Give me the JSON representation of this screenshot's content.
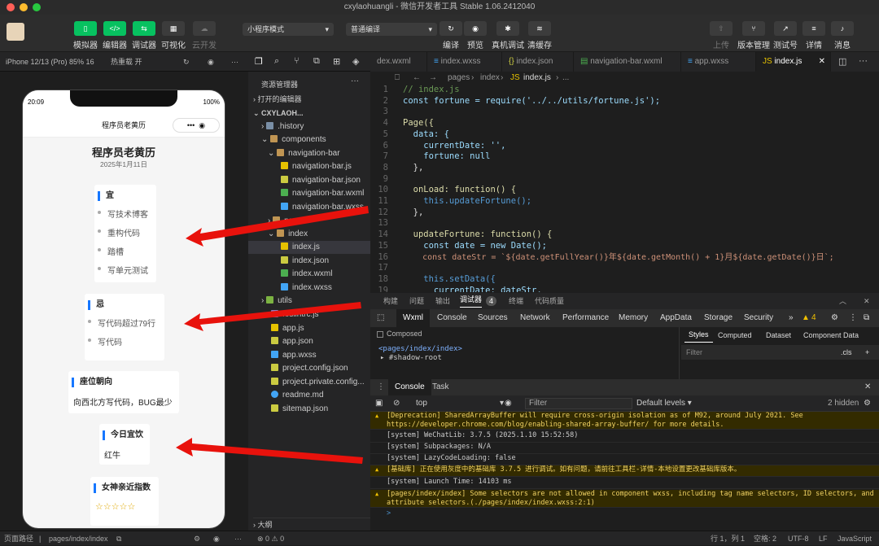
{
  "window_title": "cxylaohuangli - 微信开发者工具 Stable 1.06.2412040",
  "toolbar": {
    "simulator": "模拟器",
    "editor": "编辑器",
    "debugger": "调试器",
    "visual": "可视化",
    "cloud": "云开发",
    "mode": "小程序模式",
    "compile": "普通编译",
    "compile_btn": "编译",
    "preview": "预览",
    "realdebug": "真机调试",
    "clearcache": "清缓存",
    "upload": "上传",
    "version": "版本管理",
    "testno": "测试号",
    "detail": "详情",
    "message": "消息"
  },
  "device": {
    "model": "iPhone 12/13 (Pro) 85% 16",
    "hotreload": "热重载 开"
  },
  "phone": {
    "time": "20:09",
    "battery": "100%",
    "nav_title": "程序员老黄历",
    "page_title": "程序员老黄历",
    "date": "2025年1月11日",
    "yi": {
      "title": "宜",
      "items": [
        "写技术博客",
        "重构代码",
        "踏槽",
        "写单元测试"
      ]
    },
    "ji": {
      "title": "忌",
      "items": [
        "写代码超过79行",
        "写代码"
      ]
    },
    "seat": {
      "title": "座位朝向",
      "text": "向西北方写代码，BUG最少"
    },
    "drink": {
      "title": "今日宜饮",
      "text": "红牛"
    },
    "goddess": {
      "title": "女神亲近指数",
      "stars": "☆☆☆☆☆"
    }
  },
  "explorer": {
    "title": "资源管理器",
    "open_editors": "打开的编辑器",
    "project": "CXYLAOH...",
    "items": [
      ".history",
      "components",
      "navigation-bar",
      "navigation-bar.js",
      "navigation-bar.json",
      "navigation-bar.wxml",
      "navigation-bar.wxss",
      "pages",
      "index",
      "index.js",
      "index.json",
      "index.wxml",
      "index.wxss",
      "utils",
      ".eslintrc.js",
      "app.js",
      "app.json",
      "app.wxss",
      "project.config.json",
      "project.private.config...",
      "readme.md",
      "sitemap.json"
    ],
    "outline": "大纲"
  },
  "tabs": [
    "dex.wxml",
    "index.wxss",
    "index.json",
    "navigation-bar.wxml",
    "app.wxss",
    "index.js"
  ],
  "breadcrumb": {
    "pages": "pages",
    "index": "index",
    "file": "index.js",
    "more": "..."
  },
  "code_lines": [
    "// index.js",
    "const fortune = require('../../utils/fortune.js');",
    "",
    "Page({",
    "  data: {",
    "    currentDate: '',",
    "    fortune: null",
    "  },",
    "",
    "  onLoad: function() {",
    "    this.updateFortune();",
    "  },",
    "",
    "  updateFortune: function() {",
    "    const date = new Date();",
    "    const dateStr = `${date.getFullYear()}年${date.getMonth() + 1}月${date.getDate()}日`;",
    "",
    "    this.setData({",
    "      currentDate: dateStr,"
  ],
  "line_numbers": [
    "1",
    "2",
    "3",
    "4",
    "5",
    "6",
    "7",
    "8",
    "9",
    "10",
    "11",
    "12",
    "13",
    "14",
    "15",
    "16",
    "17",
    "18",
    "19"
  ],
  "devtools": {
    "tabs1": [
      "构建",
      "问题",
      "输出",
      "调试器",
      "4",
      "终端",
      "代码质量"
    ],
    "tabs2": [
      "Wxml",
      "Console",
      "Sources",
      "Network",
      "Performance",
      "Memory",
      "AppData",
      "Storage",
      "Security"
    ],
    "warn_count": "4",
    "composed": "Composed",
    "styles": "Styles",
    "computed": "Computed",
    "dataset": "Dataset",
    "component_data": "Component Data",
    "node1": "<pages/index/index>",
    "node2": "#shadow-root",
    "filter": "Filter",
    "cls": ".cls"
  },
  "console": {
    "tab": "Console",
    "task": "Task",
    "context": "top",
    "filter": "Filter",
    "levels": "Default levels",
    "hidden": "2 hidden",
    "messages": [
      {
        "type": "warn",
        "text": "[Deprecation] SharedArrayBuffer will require cross-origin isolation as of M92, around July 2021. See https://developer.chrome.com/blog/enabling-shared-array-buffer/ for more details."
      },
      {
        "type": "log",
        "text": "[system] WeChatLib: 3.7.5 (2025.1.10 15:52:58)"
      },
      {
        "type": "log",
        "text": "[system] Subpackages: N/A"
      },
      {
        "type": "log",
        "text": "[system] LazyCodeLoading: false"
      },
      {
        "type": "warn",
        "text": "[基础库] 正在使用灰度中的基础库 3.7.5 进行调试。如有问题，请前往工具栏-详情-本地设置更改基础库版本。"
      },
      {
        "type": "log",
        "text": "[system] Launch Time: 14103 ms"
      },
      {
        "type": "warn",
        "text": "[pages/index/index] Some selectors are not allowed in component wxss, including tag name selectors, ID selectors, and attribute selectors.(./pages/index/index.wxss:2:1)"
      }
    ],
    "prompt": ">"
  },
  "statusbar": {
    "path_label": "页面路径",
    "path": "pages/index/index",
    "errors": "⊗ 0 ⚠ 0",
    "pos": "行 1，列 1",
    "spaces": "空格: 2",
    "encoding": "UTF-8",
    "eol": "LF",
    "lang": "JavaScript"
  }
}
